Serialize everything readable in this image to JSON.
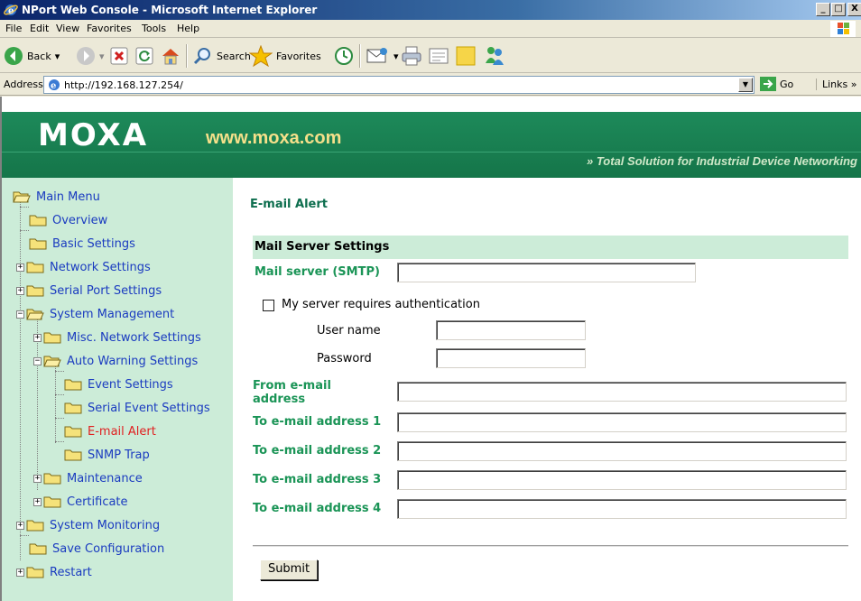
{
  "window": {
    "title": "NPort Web Console - Microsoft Internet Explorer",
    "minimize": "_",
    "maximize": "□",
    "close": "X"
  },
  "menu": [
    "File",
    "Edit",
    "View",
    "Favorites",
    "Tools",
    "Help"
  ],
  "toolbar": {
    "back": "Back",
    "search": "Search",
    "favorites": "Favorites"
  },
  "address": {
    "label": "Address",
    "url": "http://192.168.127.254/",
    "go": "Go",
    "links": "Links »"
  },
  "banner": {
    "logo": "MOXA",
    "site": "www.moxa.com",
    "slogan": "» Total Solution for Industrial Device Networking"
  },
  "tree": {
    "main_menu": "Main Menu",
    "overview": "Overview",
    "basic_settings": "Basic Settings",
    "network_settings": "Network Settings",
    "serial_port_settings": "Serial Port Settings",
    "system_management": "System Management",
    "misc_network_settings": "Misc. Network Settings",
    "auto_warning_settings": "Auto Warning Settings",
    "event_settings": "Event Settings",
    "serial_event_settings": "Serial Event Settings",
    "email_alert": "E-mail Alert",
    "snmp_trap": "SNMP Trap",
    "maintenance": "Maintenance",
    "certificate": "Certificate",
    "system_monitoring": "System Monitoring",
    "save_configuration": "Save Configuration",
    "restart": "Restart"
  },
  "form": {
    "page_title": "E-mail Alert",
    "section_title": "Mail Server Settings",
    "mail_server_label": "Mail server (SMTP)",
    "mail_server_value": "",
    "auth_label": "My server requires authentication",
    "auth_checked": false,
    "username_label": "User name",
    "username_value": "",
    "password_label": "Password",
    "password_value": "",
    "from_label_line1": "From e-mail",
    "from_label_line2": "address",
    "from_value": "",
    "to_labels": [
      "To e-mail address 1",
      "To e-mail address 2",
      "To e-mail address 3",
      "To e-mail address 4"
    ],
    "to_values": [
      "",
      "",
      "",
      ""
    ],
    "submit": "Submit"
  },
  "colors": {
    "banner_green": "#157549",
    "tree_bg": "#ccecd8",
    "link_blue": "#1a3bc0",
    "active_red": "#e02020",
    "label_green": "#1a9456"
  }
}
